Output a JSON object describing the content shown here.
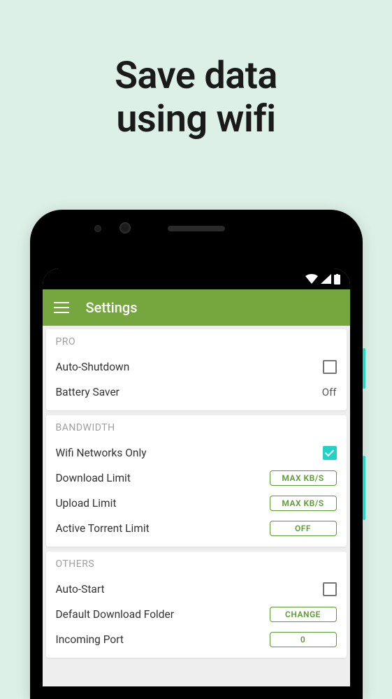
{
  "headline": {
    "line1": "Save data",
    "line2": "using wifi"
  },
  "app": {
    "title": "Settings"
  },
  "sections": {
    "pro": {
      "title": "PRO",
      "auto_shutdown": {
        "label": "Auto-Shutdown"
      },
      "battery_saver": {
        "label": "Battery Saver",
        "value": "Off"
      }
    },
    "bandwidth": {
      "title": "BANDWIDTH",
      "wifi_only": {
        "label": "Wifi Networks Only",
        "checked": true
      },
      "download_limit": {
        "label": "Download Limit",
        "button": "MAX KB/S"
      },
      "upload_limit": {
        "label": "Upload Limit",
        "button": "MAX KB/S"
      },
      "active_torrent_limit": {
        "label": "Active Torrent Limit",
        "button": "OFF"
      }
    },
    "others": {
      "title": "OTHERS",
      "auto_start": {
        "label": "Auto-Start"
      },
      "default_folder": {
        "label": "Default Download Folder",
        "button": "CHANGE"
      },
      "incoming_port": {
        "label": "Incoming Port",
        "button": "0"
      }
    }
  }
}
